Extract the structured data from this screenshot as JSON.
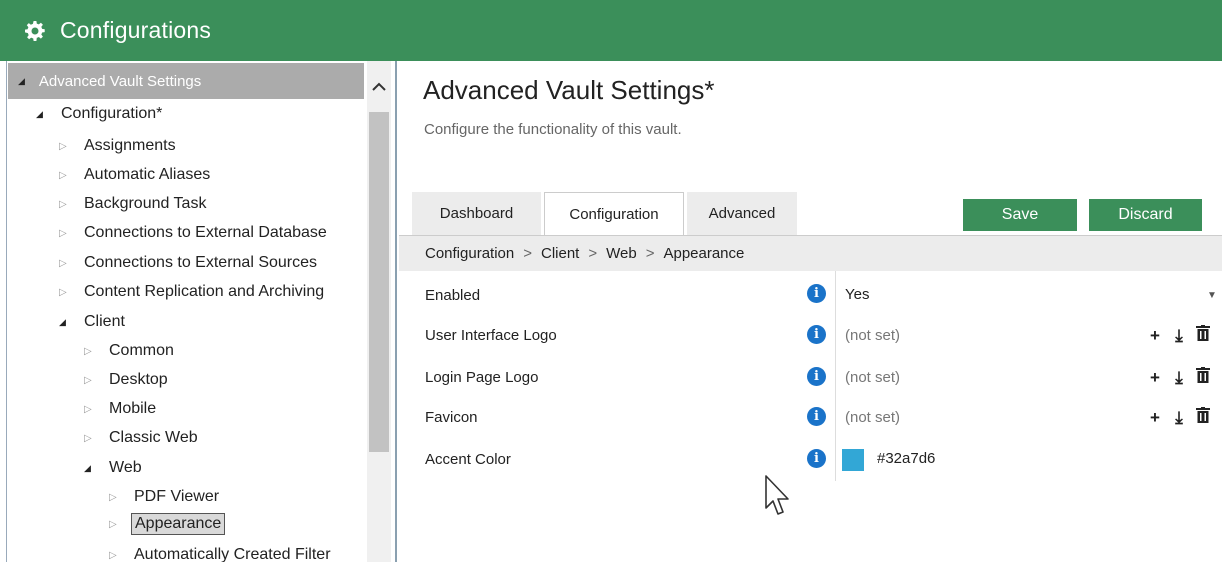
{
  "window": {
    "title": "Configurations",
    "icon": "gear-icon"
  },
  "sidebar": {
    "header": "Advanced Vault Settings",
    "items": [
      {
        "label": "Configuration*",
        "expanded": true
      },
      {
        "label": "Assignments"
      },
      {
        "label": "Automatic Aliases"
      },
      {
        "label": "Background Task"
      },
      {
        "label": "Connections to External Database"
      },
      {
        "label": "Connections to External Sources"
      },
      {
        "label": "Content Replication and Archiving"
      },
      {
        "label": "Client",
        "expanded": true
      },
      {
        "label": "Common"
      },
      {
        "label": "Desktop"
      },
      {
        "label": "Mobile"
      },
      {
        "label": "Classic Web"
      },
      {
        "label": "Web",
        "expanded": true
      },
      {
        "label": "PDF Viewer"
      },
      {
        "label": "Appearance",
        "selected": true
      },
      {
        "label": "Automatically Created Filter"
      }
    ]
  },
  "main": {
    "title": "Advanced Vault Settings*",
    "subtitle": "Configure the functionality of this vault.",
    "tabs": [
      {
        "label": "Dashboard"
      },
      {
        "label": "Configuration",
        "active": true
      },
      {
        "label": "Advanced"
      }
    ],
    "save_label": "Save",
    "discard_label": "Discard",
    "breadcrumb": [
      "Configuration",
      "Client",
      "Web",
      "Appearance"
    ],
    "breadcrumb_sep": ">",
    "rows": [
      {
        "label": "Enabled",
        "value": "Yes"
      },
      {
        "label": "User Interface Logo",
        "value": "(not set)"
      },
      {
        "label": "Login Page Logo",
        "value": "(not set)"
      },
      {
        "label": "Favicon",
        "value": "(not set)"
      },
      {
        "label": "Accent Color",
        "value": "#32a7d6"
      }
    ],
    "info_glyph": "i",
    "action_add": "+",
    "action_import": "⤓",
    "action_delete": "🗑"
  },
  "colors": {
    "brand": "#3b8f5a",
    "accent": "#32a7d6",
    "info": "#1a73c9"
  }
}
